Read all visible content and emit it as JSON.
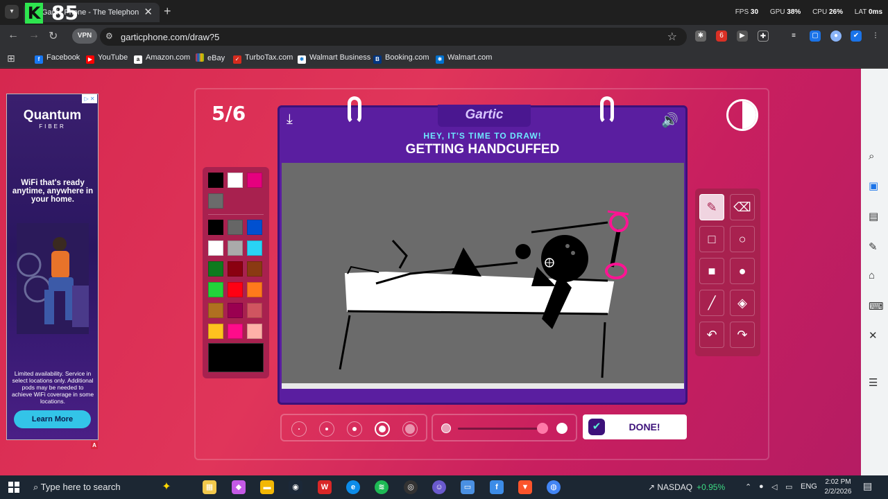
{
  "browser": {
    "tab_title": "Gartic Phone - The Telephone Game",
    "overlay_logo": "K",
    "overlay_number": "85",
    "perf": {
      "fps_label": "FPS",
      "fps": "30",
      "gpu_label": "GPU",
      "gpu": "38%",
      "cpu_label": "CPU",
      "cpu": "26%",
      "lat_label": "LAT",
      "lat": "0ms"
    },
    "vpn_label": "VPN",
    "url": "garticphone.com/draw?5",
    "ext_badge": "6",
    "bookmarks": [
      "Facebook",
      "YouTube",
      "Amazon.com",
      "eBay",
      "TurboTax.com",
      "Walmart Business",
      "Booking.com",
      "Walmart.com"
    ]
  },
  "ad": {
    "brand": "Quantum",
    "brand_sub": "FIBER",
    "headline": "WiFi that's ready anytime, anywhere in your home.",
    "fine_print": "Limited availability. Service in select locations only. Additional pods may be needed to achieve WiFi coverage in some locations.",
    "cta": "Learn More",
    "badge": "A"
  },
  "game": {
    "round": "5/6",
    "logo": "Gartic",
    "hint": "HEY, IT'S TIME TO DRAW!",
    "word": "GETTING HANDCUFFED",
    "done_label": "DONE!",
    "selected_color": "#000000",
    "palette_top": [
      "#000000",
      "#ffffff",
      "#e6007e",
      "#6b6b6b"
    ],
    "palette": [
      "#000000",
      "#666666",
      "#0050d0",
      "#ffffff",
      "#aaaaaa",
      "#29d3f5",
      "#0f7a1e",
      "#8a0010",
      "#8a3a12",
      "#22d33a",
      "#ff0013",
      "#ff7a1c",
      "#b07020",
      "#9a0050",
      "#d05560",
      "#ffc21f",
      "#ff0c8a",
      "#ffb0a8"
    ],
    "tools": [
      "pencil",
      "eraser",
      "rectangle-outline",
      "circle-outline",
      "rectangle-fill",
      "circle-fill",
      "line",
      "fill-bucket",
      "undo",
      "redo"
    ],
    "active_tool": "pencil",
    "brush_size_selected": 4,
    "opacity_level": 1.0
  },
  "taskbar": {
    "search_placeholder": "Type here to search",
    "ticker_name": "NASDAQ",
    "ticker_change": "+0.95%",
    "language": "ENG",
    "time": "2:02 PM",
    "date": "2/2/2026"
  }
}
